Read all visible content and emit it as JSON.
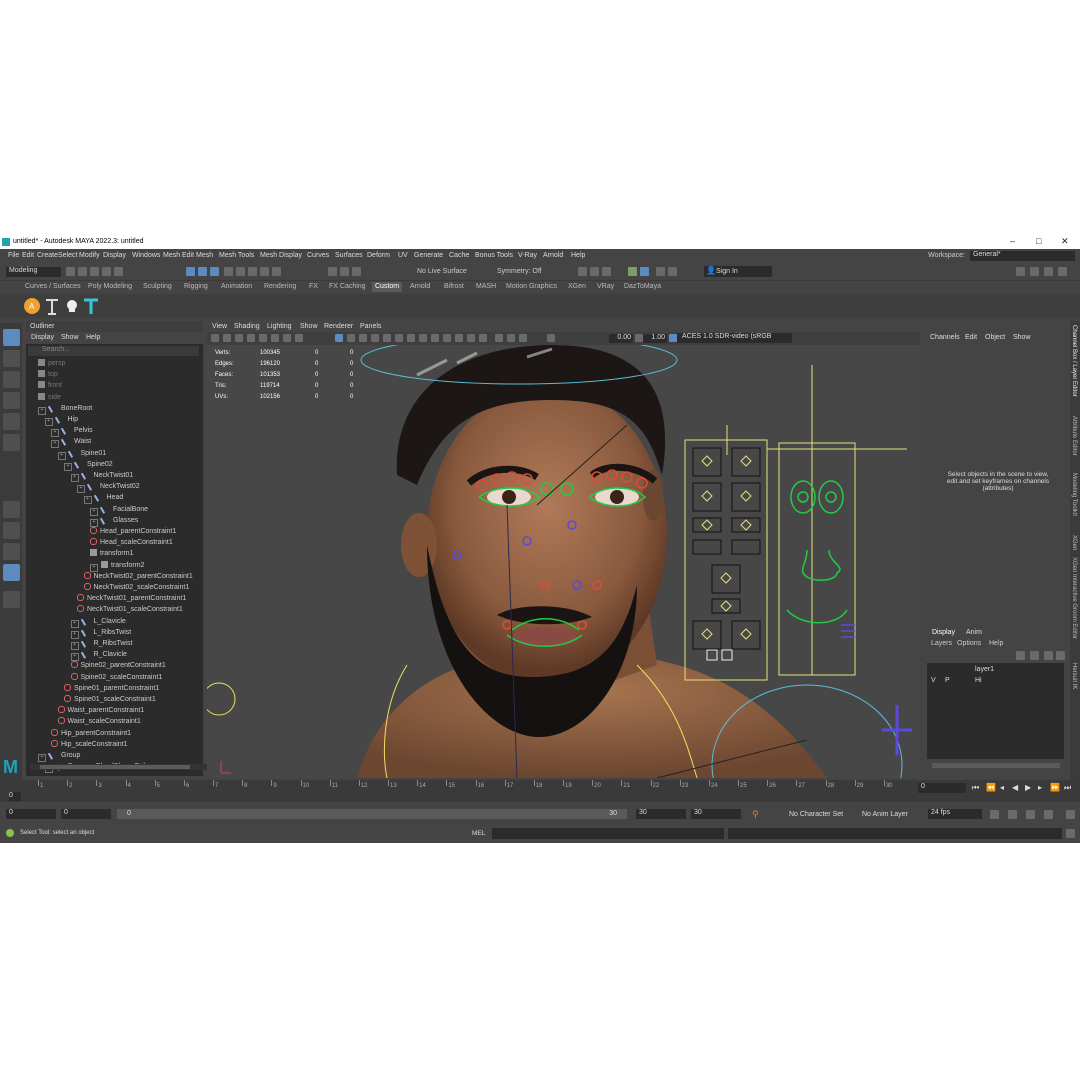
{
  "window": {
    "title": "untitled* - Autodesk MAYA 2022.3: untitled",
    "controls": [
      "–",
      "□",
      "✕"
    ]
  },
  "menubar": {
    "items": [
      "File",
      "Edit",
      "Create",
      "Select",
      "Modify",
      "Display",
      "Windows",
      "Mesh",
      "Edit Mesh",
      "Mesh Tools",
      "Mesh Display",
      "Curves",
      "Surfaces",
      "Deform",
      "UV",
      "Generate",
      "Cache",
      "Bonus Tools",
      "V-Ray",
      "Arnold",
      "Help"
    ],
    "workspace_label": "Workspace:",
    "workspace_value": "General*"
  },
  "statusline": {
    "mode": "Modeling",
    "live_surface": "No Live Surface",
    "symmetry": "Symmetry: Off",
    "sign_in": "Sign In"
  },
  "shelf": {
    "tabs": [
      "Curves / Surfaces",
      "Poly Modeling",
      "Sculpting",
      "Rigging",
      "Animation",
      "Rendering",
      "FX",
      "FX Caching",
      "Custom",
      "Arnold",
      "Bifrost",
      "MASH",
      "Motion Graphics",
      "XGen",
      "VRay",
      "DazToMaya"
    ],
    "active_tab": "Custom"
  },
  "outliner": {
    "title": "Outliner",
    "menu": [
      "Display",
      "Show",
      "Help"
    ],
    "search_placeholder": "Search...",
    "rows": [
      {
        "label": "persp",
        "depth": 0,
        "icon": "cam",
        "dim": true
      },
      {
        "label": "top",
        "depth": 0,
        "icon": "cam",
        "dim": true
      },
      {
        "label": "front",
        "depth": 0,
        "icon": "cam",
        "dim": true
      },
      {
        "label": "side",
        "depth": 0,
        "icon": "cam",
        "dim": true
      },
      {
        "label": "BoneRoot",
        "depth": 0,
        "icon": "j",
        "ex": true
      },
      {
        "label": "Hip",
        "depth": 1,
        "icon": "j",
        "ex": true
      },
      {
        "label": "Pelvis",
        "depth": 2,
        "icon": "j",
        "ex": true
      },
      {
        "label": "Waist",
        "depth": 2,
        "icon": "j",
        "ex": true
      },
      {
        "label": "Spine01",
        "depth": 3,
        "icon": "j",
        "ex": true
      },
      {
        "label": "Spine02",
        "depth": 4,
        "icon": "j",
        "ex": true
      },
      {
        "label": "NeckTwist01",
        "depth": 5,
        "icon": "j",
        "ex": true
      },
      {
        "label": "NeckTwist02",
        "depth": 6,
        "icon": "j",
        "ex": true
      },
      {
        "label": "Head",
        "depth": 7,
        "icon": "j",
        "ex": true
      },
      {
        "label": "FacialBone",
        "depth": 8,
        "icon": "j",
        "ex": true
      },
      {
        "label": "Glasses",
        "depth": 8,
        "icon": "j",
        "ex": true
      },
      {
        "label": "Head_parentConstraint1",
        "depth": 8,
        "icon": "c"
      },
      {
        "label": "Head_scaleConstraint1",
        "depth": 8,
        "icon": "c"
      },
      {
        "label": "transform1",
        "depth": 8,
        "icon": "t"
      },
      {
        "label": "transform2",
        "depth": 8,
        "icon": "t",
        "ex": true
      },
      {
        "label": "NeckTwist02_parentConstraint1",
        "depth": 7,
        "icon": "c"
      },
      {
        "label": "NeckTwist02_scaleConstraint1",
        "depth": 7,
        "icon": "c"
      },
      {
        "label": "NeckTwist01_parentConstraint1",
        "depth": 6,
        "icon": "c"
      },
      {
        "label": "NeckTwist01_scaleConstraint1",
        "depth": 6,
        "icon": "c"
      },
      {
        "label": "L_Clavicle",
        "depth": 5,
        "icon": "j",
        "ex": true
      },
      {
        "label": "L_RibsTwist",
        "depth": 5,
        "icon": "j",
        "ex": true
      },
      {
        "label": "R_RibsTwist",
        "depth": 5,
        "icon": "j",
        "ex": true
      },
      {
        "label": "R_Clavicle",
        "depth": 5,
        "icon": "j",
        "ex": true
      },
      {
        "label": "Spine02_parentConstraint1",
        "depth": 5,
        "icon": "c"
      },
      {
        "label": "Spine02_scaleConstraint1",
        "depth": 5,
        "icon": "c"
      },
      {
        "label": "Spine01_parentConstraint1",
        "depth": 4,
        "icon": "c"
      },
      {
        "label": "Spine01_scaleConstraint1",
        "depth": 4,
        "icon": "c"
      },
      {
        "label": "Waist_parentConstraint1",
        "depth": 3,
        "icon": "c"
      },
      {
        "label": "Waist_scaleConstraint1",
        "depth": 3,
        "icon": "c"
      },
      {
        "label": "Hip_parentConstraint1",
        "depth": 2,
        "icon": "c"
      },
      {
        "label": "Hip_scaleConstraint1",
        "depth": 2,
        "icon": "c"
      },
      {
        "label": "Group",
        "depth": 0,
        "icon": "j",
        "ex": true
      },
      {
        "label": "CommonBlendShapeCtrl",
        "depth": 1,
        "icon": "j",
        "ex": true
      }
    ]
  },
  "viewport": {
    "menu": [
      "View",
      "Shading",
      "Lighting",
      "Show",
      "Renderer",
      "Panels"
    ],
    "exposure": "0.00",
    "gamma": "1.00",
    "color_space": "ACES 1.0 SDR-video (sRGB",
    "hud": [
      {
        "label": "Verts:",
        "v1": "100345",
        "v2": "0",
        "v3": "0"
      },
      {
        "label": "Edges:",
        "v1": "196120",
        "v2": "0",
        "v3": "0"
      },
      {
        "label": "Faces:",
        "v1": "101353",
        "v2": "0",
        "v3": "0"
      },
      {
        "label": "Tris:",
        "v1": "119714",
        "v2": "0",
        "v3": "0"
      },
      {
        "label": "UVs:",
        "v1": "102156",
        "v2": "0",
        "v3": "0"
      }
    ]
  },
  "channel_box": {
    "menu": [
      "Channels",
      "Edit",
      "Object",
      "Show"
    ],
    "message": "Select objects in the scene to view, edit and set keyframes on channels (attributes)"
  },
  "side_tabs": [
    "Channel Box / Layer Editor",
    "Attribute Editor",
    "Modeling Toolkit",
    "XGen",
    "XGen Interactive Groom Editor",
    "Hersuit IK"
  ],
  "layer_editor": {
    "tabs": [
      "Display",
      "Anim"
    ],
    "menu": [
      "Layers",
      "Options",
      "Help"
    ],
    "layers": [
      {
        "v": "",
        "p": "",
        "name": "layer1"
      },
      {
        "v": "V",
        "p": "P",
        "name": "Hi"
      }
    ]
  },
  "timeline": {
    "ticks": [
      "1",
      "2",
      "3",
      "4",
      "5",
      "6",
      "7",
      "8",
      "9",
      "10",
      "11",
      "12",
      "13",
      "14",
      "15",
      "16",
      "17",
      "18",
      "19",
      "20",
      "21",
      "22",
      "23",
      "24",
      "25",
      "26",
      "27",
      "28",
      "29",
      "30"
    ],
    "current_frame": "0",
    "frame_field": "0"
  },
  "range": {
    "start": "0",
    "start_inner": "0",
    "slider_start": "0",
    "slider_end": "30",
    "end_inner": "30",
    "end": "30",
    "character_set": "No Character Set",
    "anim_layer": "No Anim Layer",
    "fps": "24 fps"
  },
  "helpline": {
    "text": "Select Tool: select an object",
    "mel": "MEL"
  },
  "colors": {
    "panel": "#444444",
    "field": "#2b2b2b",
    "accent": "#5b8bbf",
    "maya_teal": "#1fa3b5"
  }
}
